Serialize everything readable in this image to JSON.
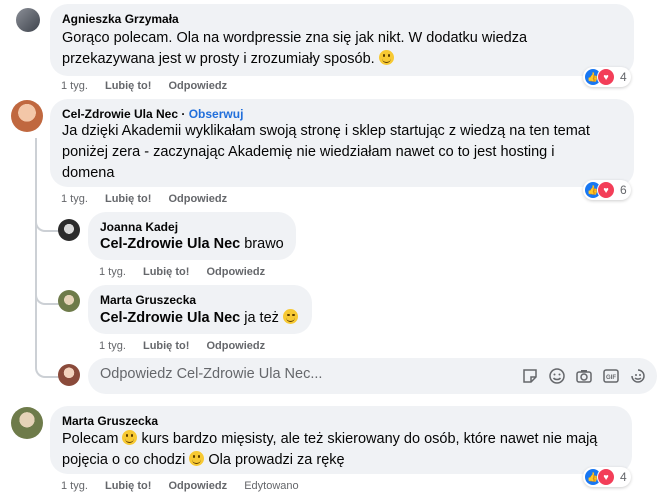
{
  "comments": [
    {
      "author": "Agnieszka Grzymała",
      "text_lines": [
        "Gorąco polecam. Ola na wordpressie zna się jak nikt. W dodatku wiedza",
        "przekazywana jest w prosty i zrozumiały sposób."
      ],
      "time": "1 tyg.",
      "like": "Lubię to!",
      "reply": "Odpowiedz",
      "reactions": "4"
    },
    {
      "author": "Cel-Zdrowie Ula Nec",
      "separator": "·",
      "follow": "Obserwuj",
      "text_lines": [
        "Ja dzięki Akademii wyklikałam swoją stronę i sklep startując z wiedzą na ten temat",
        "poniżej zera - zaczynając Akademię nie wiedziałam nawet co to jest hosting i",
        "domena"
      ],
      "time": "1 tyg.",
      "like": "Lubię to!",
      "reply": "Odpowiedz",
      "reactions": "6"
    }
  ],
  "replies": [
    {
      "author": "Joanna Kadej",
      "mention": "Cel-Zdrowie Ula Nec",
      "text": "brawo",
      "time": "1 tyg.",
      "like": "Lubię to!",
      "reply": "Odpowiedz"
    },
    {
      "author": "Marta Gruszecka",
      "mention": "Cel-Zdrowie Ula Nec",
      "text": "ja też",
      "time": "1 tyg.",
      "like": "Lubię to!",
      "reply": "Odpowiedz"
    }
  ],
  "reply_input": {
    "placeholder": "Odpowiedz Cel-Zdrowie Ula Nec..."
  },
  "last_comment": {
    "author": "Marta Gruszecka",
    "line1_a": "Polecam",
    "line1_b": "kurs bardzo mięsisty, ale też skierowany do osób, które nawet nie mają",
    "line2_a": "pojęcia o co chodzi",
    "line2_b": "Ola prowadzi za rękę",
    "time": "1 tyg.",
    "like": "Lubię to!",
    "reply": "Odpowiedz",
    "edited": "Edytowano",
    "reactions": "4"
  },
  "colors": {
    "bubble": "#f0f2f5",
    "link": "#216fdb",
    "meta": "#65676b",
    "like": "#1877f2",
    "love": "#f33e58"
  }
}
